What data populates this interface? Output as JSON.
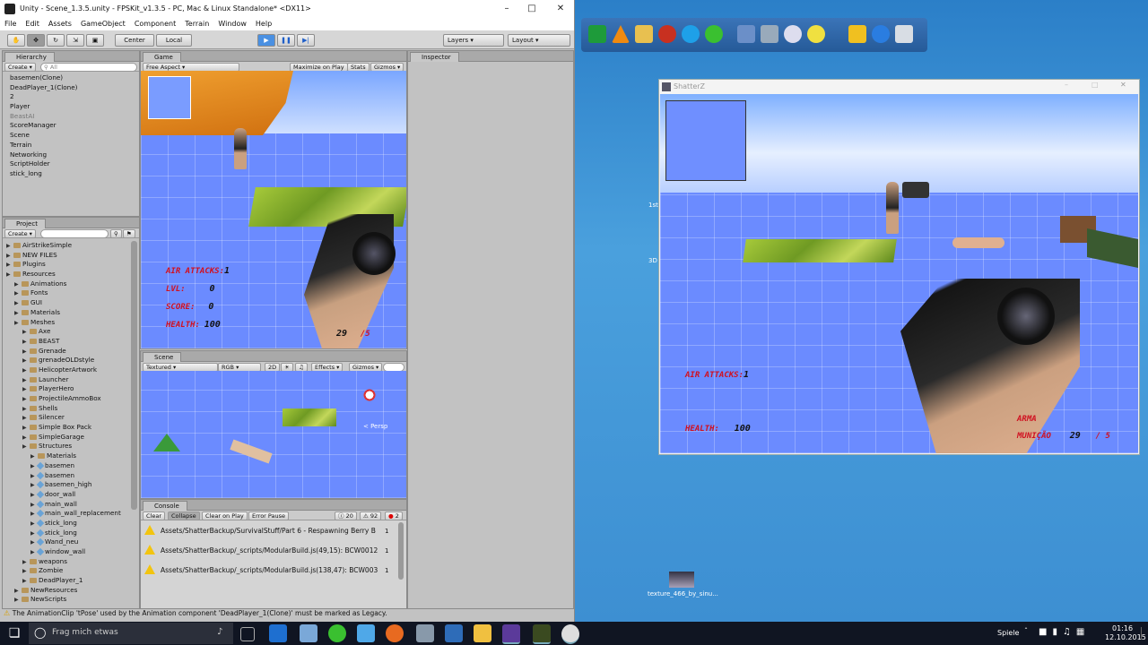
{
  "unity": {
    "title": "Unity - Scene_1.3.5.unity - FPSKit_v1.3.5 - PC, Mac & Linux Standalone* <DX11>",
    "menu": [
      "File",
      "Edit",
      "Assets",
      "GameObject",
      "Component",
      "Terrain",
      "Window",
      "Help"
    ],
    "toolbar": {
      "center": "Center",
      "local": "Local",
      "layers": "Layers",
      "layout": "Layout"
    },
    "hierarchy": {
      "tab": "Hierarchy",
      "create": "Create",
      "search_placeholder": "All",
      "items": [
        "basemen(Clone)",
        "DeadPlayer_1(Clone)",
        "2",
        "Player",
        "BeastAI",
        "ScoreManager",
        "Scene",
        "Terrain",
        "Networking",
        "ScriptHolder",
        "stick_long"
      ]
    },
    "project": {
      "tab": "Project",
      "create": "Create",
      "items": [
        {
          "label": "AirStrikeSimple",
          "indent": 0
        },
        {
          "label": "NEW FILES",
          "indent": 0
        },
        {
          "label": "Plugins",
          "indent": 0
        },
        {
          "label": "Resources",
          "indent": 0
        },
        {
          "label": "Animations",
          "indent": 1
        },
        {
          "label": "Fonts",
          "indent": 1
        },
        {
          "label": "GUI",
          "indent": 1
        },
        {
          "label": "Materials",
          "indent": 1
        },
        {
          "label": "Meshes",
          "indent": 1
        },
        {
          "label": "Axe",
          "indent": 2
        },
        {
          "label": "BEAST",
          "indent": 2
        },
        {
          "label": "Grenade",
          "indent": 2
        },
        {
          "label": "grenadeOLDstyle",
          "indent": 2
        },
        {
          "label": "HelicopterArtwork",
          "indent": 2
        },
        {
          "label": "Launcher",
          "indent": 2
        },
        {
          "label": "PlayerHero",
          "indent": 2
        },
        {
          "label": "ProjectileAmmoBox",
          "indent": 2
        },
        {
          "label": "Shells",
          "indent": 2
        },
        {
          "label": "Silencer",
          "indent": 2
        },
        {
          "label": "Simple Box Pack",
          "indent": 2
        },
        {
          "label": "SimpleGarage",
          "indent": 2
        },
        {
          "label": "Structures",
          "indent": 2
        },
        {
          "label": "Materials",
          "indent": 3
        },
        {
          "label": "basemen",
          "indent": 3
        },
        {
          "label": "basemen",
          "indent": 3
        },
        {
          "label": "basemen_high",
          "indent": 3
        },
        {
          "label": "door_wall",
          "indent": 3
        },
        {
          "label": "main_wall",
          "indent": 3
        },
        {
          "label": "main_wall_replacement",
          "indent": 3
        },
        {
          "label": "stick_long",
          "indent": 3
        },
        {
          "label": "stick_long",
          "indent": 3
        },
        {
          "label": "Wand_neu",
          "indent": 3
        },
        {
          "label": "window_wall",
          "indent": 3
        },
        {
          "label": "weapons",
          "indent": 2
        },
        {
          "label": "Zombie",
          "indent": 2
        },
        {
          "label": "DeadPlayer_1",
          "indent": 2
        },
        {
          "label": "NewResources",
          "indent": 1
        },
        {
          "label": "NewScripts",
          "indent": 1
        }
      ]
    },
    "game": {
      "tab": "Game",
      "aspect": "Free Aspect",
      "maximize": "Maximize on Play",
      "stats": "Stats",
      "gizmos": "Gizmos",
      "hud": {
        "air_label": "AIR ATTACKS:",
        "air_value": "1",
        "lvl_label": "LVL:",
        "lvl_value": "0",
        "score_label": "SCORE:",
        "score_value": "0",
        "health_label": "HEALTH:",
        "health_value": "100",
        "ammo": "29",
        "mags": "/5"
      }
    },
    "inspector": {
      "tab": "Inspector"
    },
    "scene": {
      "tab": "Scene",
      "shading": "Textured",
      "rgb": "RGB",
      "mode2d": "2D",
      "effects": "Effects",
      "gizmos": "Gizmos",
      "persp": "< Persp"
    },
    "console": {
      "tab": "Console",
      "clear": "Clear",
      "collapse": "Collapse",
      "clear_on_play": "Clear on Play",
      "error_pause": "Error Pause",
      "count_info": "20",
      "count_warn": "92",
      "count_err": "2",
      "rows": [
        {
          "text": "Assets/ShatterBackup/SurvivalStuff/Part 6 - Respawning Berry B",
          "count": "1"
        },
        {
          "text": "Assets/ShatterBackup/_scripts/ModularBuild.js(49,15): BCW0012",
          "count": "1"
        },
        {
          "text": "Assets/ShatterBackup/_scripts/ModularBuild.js(138,47): BCW003",
          "count": "1"
        }
      ]
    },
    "status": "The AnimationClip 'tPose' used by the Animation component 'DeadPlayer_1(Clone)' must be marked as Legacy."
  },
  "shatterz": {
    "title": "ShatterZ",
    "hud": {
      "air_label": "AIR ATTACKS:",
      "air_value": "1",
      "health_label": "HEALTH:",
      "health_value": "100",
      "arma_label": "ARMA",
      "municao_label": "MUNIÇÃO",
      "ammo": "29",
      "mags": "/ 5"
    },
    "side_labels": [
      "1st",
      "3D"
    ]
  },
  "desktop": {
    "file_icon_label": "texture_466_by_sinu..."
  },
  "taskbar": {
    "search_placeholder": "Frag mich etwas",
    "lang": "Spiele",
    "time": "01:16",
    "date": "12.10.2015"
  },
  "colors": {
    "hud_red": "#d01020",
    "unity_bg": "#c2c2c2",
    "sky": "#6b8bff",
    "taskbar": "#101522"
  }
}
